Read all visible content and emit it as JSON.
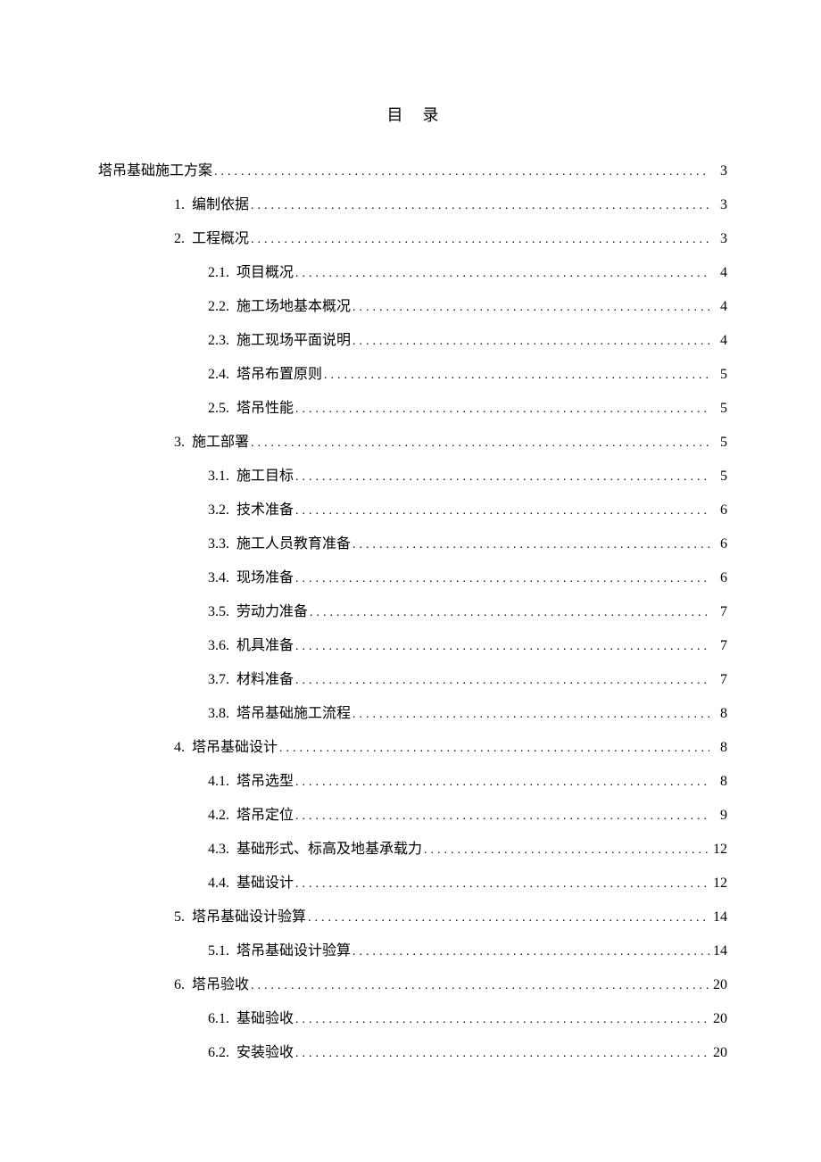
{
  "title": "目录",
  "entries": [
    {
      "level": 0,
      "num": "",
      "label": "塔吊基础施工方案",
      "page": "3"
    },
    {
      "level": 1,
      "num": "1.",
      "label": "编制依据",
      "page": "3"
    },
    {
      "level": 1,
      "num": "2.",
      "label": "工程概况",
      "page": "3"
    },
    {
      "level": 2,
      "num": "2.1.",
      "label": "项目概况",
      "page": "4"
    },
    {
      "level": 2,
      "num": "2.2.",
      "label": "施工场地基本概况",
      "page": "4"
    },
    {
      "level": 2,
      "num": "2.3.",
      "label": "施工现场平面说明",
      "page": "4"
    },
    {
      "level": 2,
      "num": "2.4.",
      "label": "塔吊布置原则",
      "page": "5"
    },
    {
      "level": 2,
      "num": "2.5.",
      "label": "塔吊性能",
      "page": "5"
    },
    {
      "level": 1,
      "num": "3.",
      "label": "施工部署",
      "page": "5"
    },
    {
      "level": 2,
      "num": "3.1.",
      "label": "施工目标",
      "page": "5"
    },
    {
      "level": 2,
      "num": "3.2.",
      "label": "技术准备",
      "page": "6"
    },
    {
      "level": 2,
      "num": "3.3.",
      "label": "施工人员教育准备",
      "page": "6"
    },
    {
      "level": 2,
      "num": "3.4.",
      "label": "现场准备",
      "page": "6"
    },
    {
      "level": 2,
      "num": "3.5.",
      "label": "劳动力准备",
      "page": "7"
    },
    {
      "level": 2,
      "num": "3.6.",
      "label": "机具准备",
      "page": "7"
    },
    {
      "level": 2,
      "num": "3.7.",
      "label": "材料准备",
      "page": "7"
    },
    {
      "level": 2,
      "num": "3.8.",
      "label": "塔吊基础施工流程",
      "page": "8"
    },
    {
      "level": 1,
      "num": "4.",
      "label": "塔吊基础设计",
      "page": "8"
    },
    {
      "level": 2,
      "num": "4.1.",
      "label": "塔吊选型",
      "page": "8"
    },
    {
      "level": 2,
      "num": "4.2.",
      "label": "塔吊定位",
      "page": "9"
    },
    {
      "level": 2,
      "num": "4.3.",
      "label": "基础形式、标高及地基承载力",
      "page": "12"
    },
    {
      "level": 2,
      "num": "4.4.",
      "label": "基础设计",
      "page": "12"
    },
    {
      "level": 1,
      "num": "5.",
      "label": "塔吊基础设计验算",
      "page": "14"
    },
    {
      "level": 2,
      "num": "5.1.",
      "label": "塔吊基础设计验算",
      "page": "14"
    },
    {
      "level": 1,
      "num": "6.",
      "label": "塔吊验收",
      "page": "20"
    },
    {
      "level": 2,
      "num": "6.1.",
      "label": "基础验收",
      "page": "20"
    },
    {
      "level": 2,
      "num": "6.2.",
      "label": "安装验收",
      "page": "20"
    }
  ]
}
